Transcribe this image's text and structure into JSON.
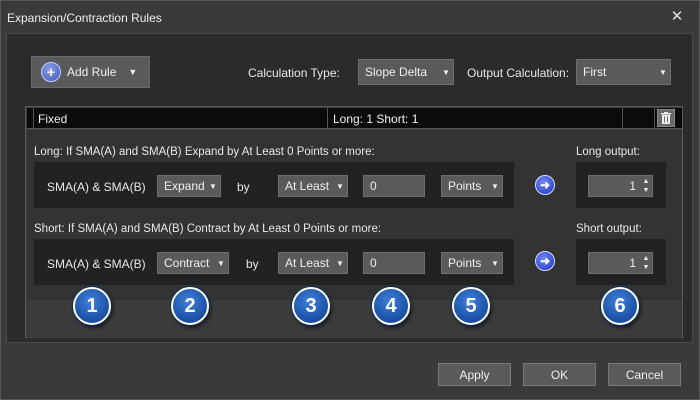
{
  "window": {
    "title": "Expansion/Contraction Rules"
  },
  "toolbar": {
    "add_rule_label": "Add Rule",
    "calc_type_label": "Calculation Type:",
    "calc_type_value": "Slope Delta",
    "output_calc_label": "Output Calculation:",
    "output_calc_value": "First"
  },
  "grid": {
    "columns": [
      "Fixed",
      "Long: 1 Short: 1"
    ]
  },
  "long": {
    "title": "Long: If SMA(A) and SMA(B) Expand by At Least 0 Points or more:",
    "subject": "SMA(A) & SMA(B)",
    "direction": "Expand",
    "by_label": "by",
    "comparison": "At Least",
    "amount": "0",
    "unit": "Points",
    "output_label": "Long output:",
    "output_value": "1"
  },
  "short": {
    "title": "Short: If SMA(A) and SMA(B) Contract by At Least 0 Points or more:",
    "subject": "SMA(A) & SMA(B)",
    "direction": "Contract",
    "by_label": "by",
    "comparison": "At Least",
    "amount": "0",
    "unit": "Points",
    "output_label": "Short output:",
    "output_value": "1"
  },
  "callouts": [
    "1",
    "2",
    "3",
    "4",
    "5",
    "6"
  ],
  "buttons": {
    "apply": "Apply",
    "ok": "OK",
    "cancel": "Cancel"
  },
  "icons": {
    "add": "plus-circle-icon",
    "delete": "trash-icon",
    "go": "arrow-right-circle-icon",
    "close": "close-icon"
  },
  "colors": {
    "accent": "#2c4fc4",
    "callout": "#1a5fc0",
    "header": "#0b0b0b"
  }
}
